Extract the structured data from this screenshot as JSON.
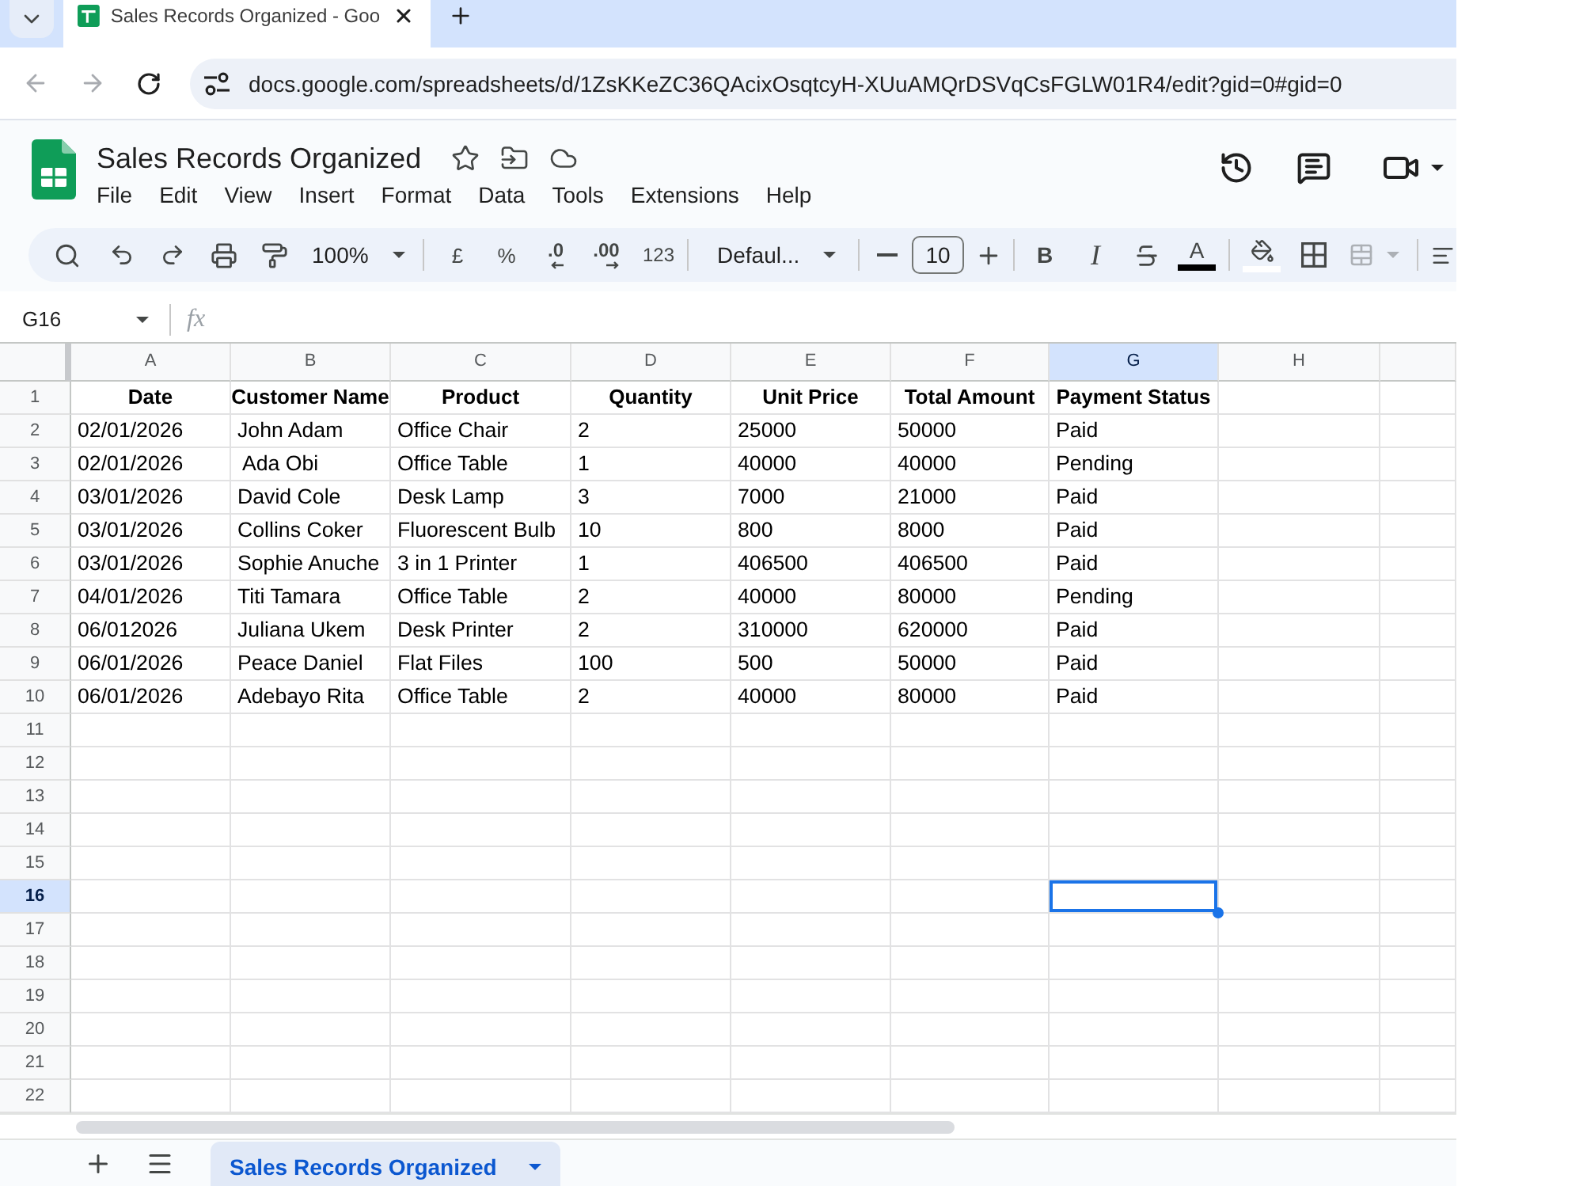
{
  "browser": {
    "tabs": [
      {
        "title": "Sales Records Organized - Goo",
        "selected": true
      }
    ],
    "back": {
      "disabled": true
    },
    "forward": {
      "disabled": true
    },
    "address": "docs.google.com/spreadsheets/d/1ZsKKeZC36QAcixOsqtcyH-XUuAMQrDSVqCsFGLW01R4/edit?gid=0#gid=0"
  },
  "header": {
    "title": "Sales Records Organized",
    "menu": [
      "File",
      "Edit",
      "View",
      "Insert",
      "Format",
      "Data",
      "Tools",
      "Extensions",
      "Help"
    ]
  },
  "toolbar": {
    "zoom": "100%",
    "currency": "£",
    "percent": "%",
    "decimal_decrease": ".0",
    "decimal_increase": ".00",
    "number_format": "123",
    "font": "Defaul...",
    "font_size": "10",
    "bold": "B",
    "italic": "I",
    "text_color": "A",
    "merge": {
      "disabled": true
    }
  },
  "formula_bar": {
    "cell_reference": "G16",
    "function_label": "fx"
  },
  "grid": {
    "columns": [
      {
        "label": "A",
        "selected": false
      },
      {
        "label": "B",
        "selected": false
      },
      {
        "label": "C",
        "selected": false
      },
      {
        "label": "D",
        "selected": false
      },
      {
        "label": "E",
        "selected": false
      },
      {
        "label": "F",
        "selected": false
      },
      {
        "label": "G",
        "selected": true
      },
      {
        "label": "H",
        "selected": false
      }
    ],
    "rows": [
      {
        "number": "1",
        "selected": false,
        "kind": "header",
        "cells": [
          "Date",
          "Customer Name",
          "Product",
          "Quantity",
          "Unit Price",
          "Total Amount",
          "Payment Status"
        ]
      },
      {
        "number": "2",
        "selected": false,
        "kind": "data",
        "cells": [
          "02/01/2026",
          "John Adam",
          "Office Chair",
          "2",
          "25000",
          "50000",
          "Paid"
        ]
      },
      {
        "number": "3",
        "selected": false,
        "kind": "data",
        "cells": [
          "02/01/2026",
          " Ada Obi",
          "Office Table",
          "1",
          "40000",
          "40000",
          "Pending"
        ]
      },
      {
        "number": "4",
        "selected": false,
        "kind": "data",
        "cells": [
          "03/01/2026",
          "David Cole",
          "Desk Lamp",
          "3",
          "7000",
          "21000",
          "Paid"
        ]
      },
      {
        "number": "5",
        "selected": false,
        "kind": "data",
        "cells": [
          "03/01/2026",
          "Collins Coker",
          "Fluorescent Bulb",
          "10",
          "800",
          "8000",
          "Paid"
        ]
      },
      {
        "number": "6",
        "selected": false,
        "kind": "data",
        "cells": [
          "03/01/2026",
          "Sophie Anuche",
          "3 in 1 Printer",
          "1",
          "406500",
          "406500",
          "Paid"
        ]
      },
      {
        "number": "7",
        "selected": false,
        "kind": "data",
        "cells": [
          "04/01/2026",
          "Titi Tamara",
          "Office Table",
          "2",
          "40000",
          "80000",
          "Pending"
        ]
      },
      {
        "number": "8",
        "selected": false,
        "kind": "data",
        "cells": [
          "06/012026",
          "Juliana Ukem",
          "Desk Printer",
          "2",
          "310000",
          "620000",
          "Paid"
        ]
      },
      {
        "number": "9",
        "selected": false,
        "kind": "data",
        "cells": [
          "06/01/2026",
          "Peace Daniel",
          "Flat Files",
          "100",
          "500",
          "50000",
          "Paid"
        ]
      },
      {
        "number": "10",
        "selected": false,
        "kind": "data",
        "cells": [
          "06/01/2026",
          "Adebayo Rita",
          "Office Table",
          "2",
          "40000",
          "80000",
          "Paid"
        ]
      },
      {
        "number": "11",
        "selected": false,
        "kind": "empty"
      },
      {
        "number": "12",
        "selected": false,
        "kind": "empty"
      },
      {
        "number": "13",
        "selected": false,
        "kind": "empty"
      },
      {
        "number": "14",
        "selected": false,
        "kind": "empty"
      },
      {
        "number": "15",
        "selected": false,
        "kind": "empty"
      },
      {
        "number": "16",
        "selected": true,
        "kind": "empty"
      },
      {
        "number": "17",
        "selected": false,
        "kind": "empty"
      },
      {
        "number": "18",
        "selected": false,
        "kind": "empty"
      },
      {
        "number": "19",
        "selected": false,
        "kind": "empty"
      },
      {
        "number": "20",
        "selected": false,
        "kind": "empty"
      },
      {
        "number": "21",
        "selected": false,
        "kind": "empty"
      },
      {
        "number": "22",
        "selected": false,
        "kind": "empty"
      }
    ]
  },
  "sheet_tabs": [
    {
      "label": "Sales Records Organized",
      "selected": true
    }
  ]
}
